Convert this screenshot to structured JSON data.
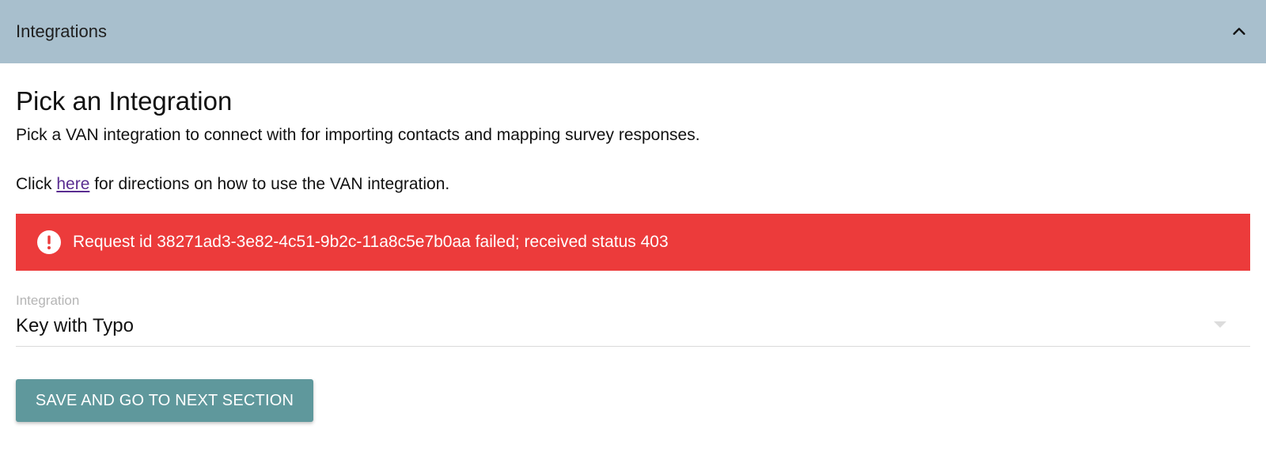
{
  "section": {
    "title": "Integrations",
    "toggle_icon": "chevron-up-icon"
  },
  "main": {
    "heading": "Pick an Integration",
    "description": "Pick a VAN integration to connect with for importing contacts and mapping survey responses.",
    "directions_prefix": "Click ",
    "directions_link": "here",
    "directions_suffix": " for directions on how to use the VAN integration."
  },
  "error_alert": {
    "icon": "error-icon",
    "message": "Request id 38271ad3-3e82-4c51-9b2c-11a8c5e7b0aa failed; received status 403",
    "color": "#ec3b3b"
  },
  "integration_select": {
    "label": "Integration",
    "value": "Key with Typo"
  },
  "save_button": {
    "label": "SAVE AND GO TO NEXT SECTION",
    "color": "#5f989c"
  },
  "colors": {
    "header_bg": "#a8bfcd",
    "link": "#5a2d91"
  }
}
